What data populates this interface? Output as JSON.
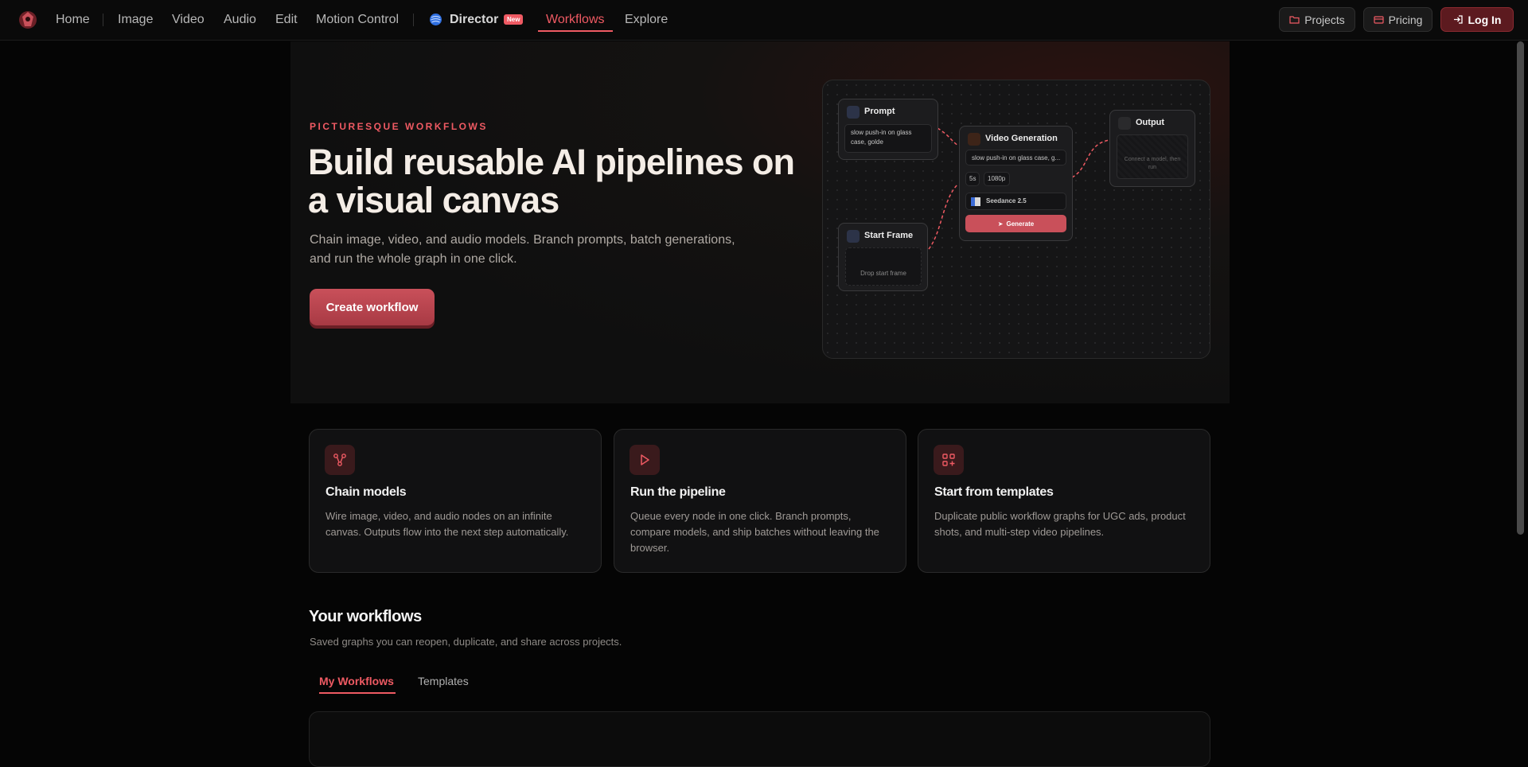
{
  "nav": {
    "home": "Home",
    "image": "Image",
    "video": "Video",
    "audio": "Audio",
    "edit": "Edit",
    "motion_control": "Motion Control",
    "director": "Director",
    "director_badge": "New",
    "workflows": "Workflows",
    "explore": "Explore"
  },
  "top_buttons": {
    "projects": "Projects",
    "pricing": "Pricing",
    "login": "Log In"
  },
  "hero": {
    "eyebrow": "PICTURESQUE WORKFLOWS",
    "title": "Build reusable AI pipelines on a visual canvas",
    "subtitle": "Chain image, video, and audio models. Branch prompts, batch generations, and run the whole graph in one click.",
    "cta": "Create workflow"
  },
  "canvas": {
    "prompt_node": {
      "title": "Prompt",
      "text": "slow push-in on glass case, golde"
    },
    "start_frame_node": {
      "title": "Start Frame",
      "drop_text": "Drop start frame"
    },
    "video_node": {
      "title": "Video Generation",
      "prompt": "slow push-in on glass case, g...",
      "duration": "5s",
      "resolution": "1080p",
      "model": "Seedance 2.5",
      "generate": "Generate"
    },
    "output_node": {
      "title": "Output",
      "text": "Connect a model, then run"
    }
  },
  "features": [
    {
      "title": "Chain models",
      "text": "Wire image, video, and audio nodes on an infinite canvas. Outputs flow into the next step automatically.",
      "icon": "nodes-icon"
    },
    {
      "title": "Run the pipeline",
      "text": "Queue every node in one click. Branch prompts, compare models, and ship batches without leaving the browser.",
      "icon": "play-icon"
    },
    {
      "title": "Start from templates",
      "text": "Duplicate public workflow graphs for UGC ads, product shots, and multi-step video pipelines.",
      "icon": "grid-plus-icon"
    }
  ],
  "workflows": {
    "title": "Your workflows",
    "subtitle": "Saved graphs you can reopen, duplicate, and share across projects.",
    "tabs": [
      "My Workflows",
      "Templates"
    ]
  },
  "colors": {
    "accent": "#ef5a63",
    "background": "#050505"
  }
}
